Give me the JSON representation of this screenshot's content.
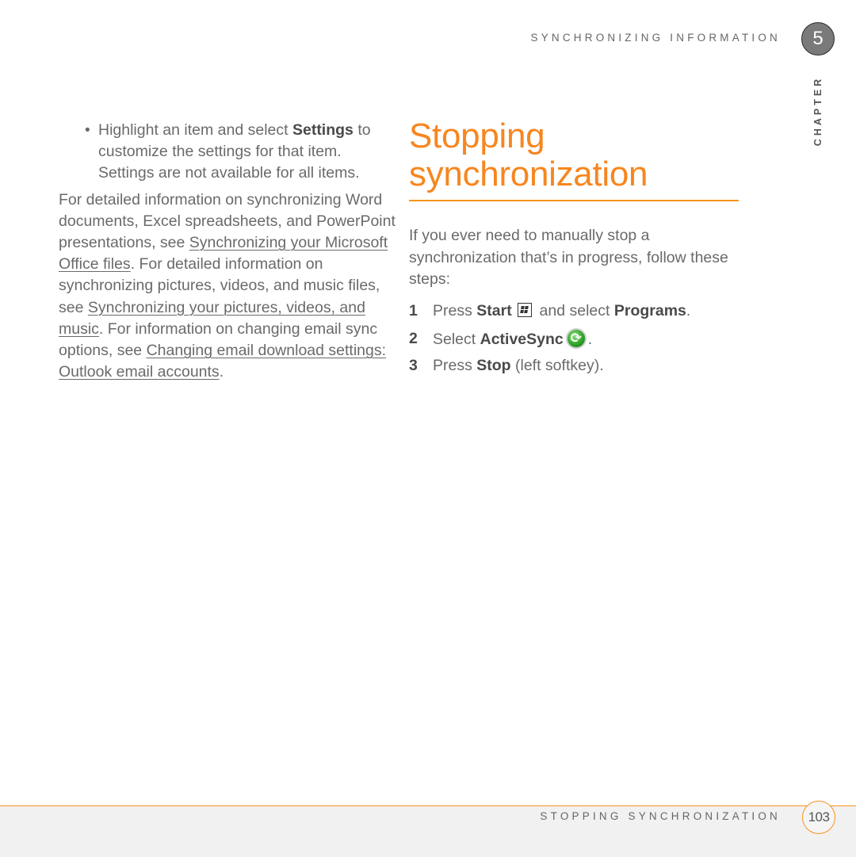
{
  "header": {
    "running_title": "SYNCHRONIZING INFORMATION",
    "chapter_number": "5",
    "chapter_label": "CHAPTER"
  },
  "left_column": {
    "bullet": {
      "text_before": "Highlight an item and select ",
      "bold": "Settings",
      "text_after": " to customize the settings for that item. Settings are not available for all items."
    },
    "paragraph": {
      "t1": "For detailed information on synchronizing Word documents, Excel spreadsheets, and PowerPoint presentations, see ",
      "link1": "Synchronizing your Microsoft Office files",
      "t2": ". For detailed information on synchronizing pictures, videos, and music files, see ",
      "link2": "Synchronizing your pictures, videos, and music",
      "t3": ". For information on changing email sync options, see ",
      "link3": "Changing email download settings: Outlook email accounts",
      "t4": "."
    }
  },
  "section": {
    "heading": "Stopping synchronization",
    "intro": "If you ever need to manually stop a synchronization that’s in progress, follow these steps:",
    "steps": [
      {
        "num": "1",
        "pre": "Press ",
        "bold1": "Start",
        "icon": "windows-start-icon",
        "mid": " and select ",
        "bold2": "Programs",
        "post": "."
      },
      {
        "num": "2",
        "pre": "Select ",
        "bold1": "ActiveSync",
        "icon": "activesync-icon",
        "post": "."
      },
      {
        "num": "3",
        "pre": "Press ",
        "bold1": "Stop",
        "post": " (left softkey)."
      }
    ]
  },
  "footer": {
    "section_title": "STOPPING SYNCHRONIZATION",
    "page_number": "103"
  },
  "colors": {
    "accent": "#f7861f",
    "body_text": "#6a6a6a",
    "footer_bg": "#f1f1f1",
    "badge_gray": "#7a7a7a"
  }
}
